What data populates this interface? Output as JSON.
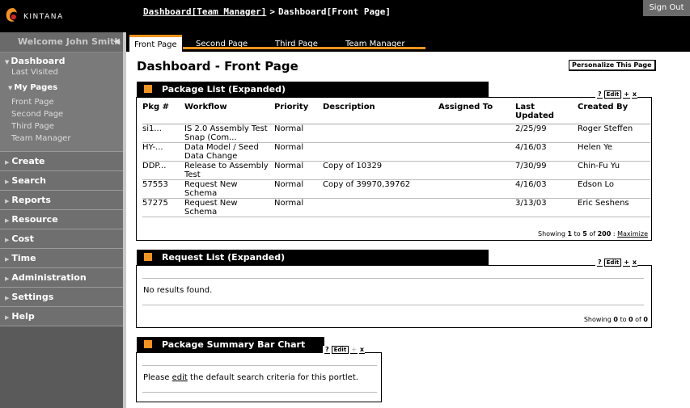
{
  "app": {
    "logo_text": "KINTANA",
    "sign_out": "Sign Out"
  },
  "breadcrumb": {
    "link": "Dashboard[Team Manager]",
    "separator": ">",
    "current": "Dashboard[Front Page]"
  },
  "sidebar": {
    "welcome": "Welcome John Smith",
    "dashboard": "Dashboard",
    "last_visited": "Last Visited",
    "my_pages": "My Pages",
    "pages": [
      "Front Page",
      "Second Page",
      "Third Page",
      "Team Manager"
    ],
    "sections": [
      "Create",
      "Search",
      "Reports",
      "Resource",
      "Cost",
      "Time",
      "Administration",
      "Settings",
      "Help"
    ]
  },
  "tabs": [
    "Front Page",
    "Second Page",
    "Third Page",
    "Team Manager"
  ],
  "page": {
    "title": "Dashboard - Front Page",
    "personalize": "Personalize This Page"
  },
  "controls": {
    "help": "?",
    "edit": "Edit",
    "add": "+",
    "close": "x"
  },
  "package_list": {
    "title": "Package List (Expanded)",
    "columns": [
      "Pkg #",
      "Workflow",
      "Priority",
      "Description",
      "Assigned To",
      "Last Updated",
      "Created By"
    ],
    "rows": [
      [
        "si1...",
        "IS 2.0 Assembly Test Snap (Com...",
        "Normal",
        "",
        "",
        "2/25/99",
        "Roger Steffen"
      ],
      [
        "HY-...",
        "Data Model / Seed Data Change",
        "Normal",
        "",
        "",
        "4/16/03",
        "Helen Ye"
      ],
      [
        "DDP...",
        "Release to Assembly Test",
        "Normal",
        "Copy of 10329",
        "",
        "7/30/99",
        "Chin-Fu Yu"
      ],
      [
        "57553",
        "Request New Schema",
        "Normal",
        "Copy of 39970,39762",
        "",
        "4/16/03",
        "Edson Lo"
      ],
      [
        "57275",
        "Request New Schema",
        "Normal",
        "",
        "",
        "3/13/03",
        "Eric Seshens"
      ]
    ],
    "footer": {
      "prefix": "Showing",
      "from": "1",
      "to_word": "to",
      "to": "5",
      "of_word": "of",
      "total": "200",
      "sep": ":",
      "maximize": "Maximize"
    }
  },
  "request_list": {
    "title": "Request List (Expanded)",
    "message": "No results found.",
    "footer": {
      "prefix": "Showing",
      "from": "0",
      "to_word": "to",
      "to": "0",
      "of_word": "of",
      "total": "0"
    }
  },
  "bar_chart": {
    "title": "Package Summary Bar Chart",
    "msg_pre": "Please",
    "msg_link": "edit",
    "msg_post": "the default search criteria for this portlet."
  }
}
